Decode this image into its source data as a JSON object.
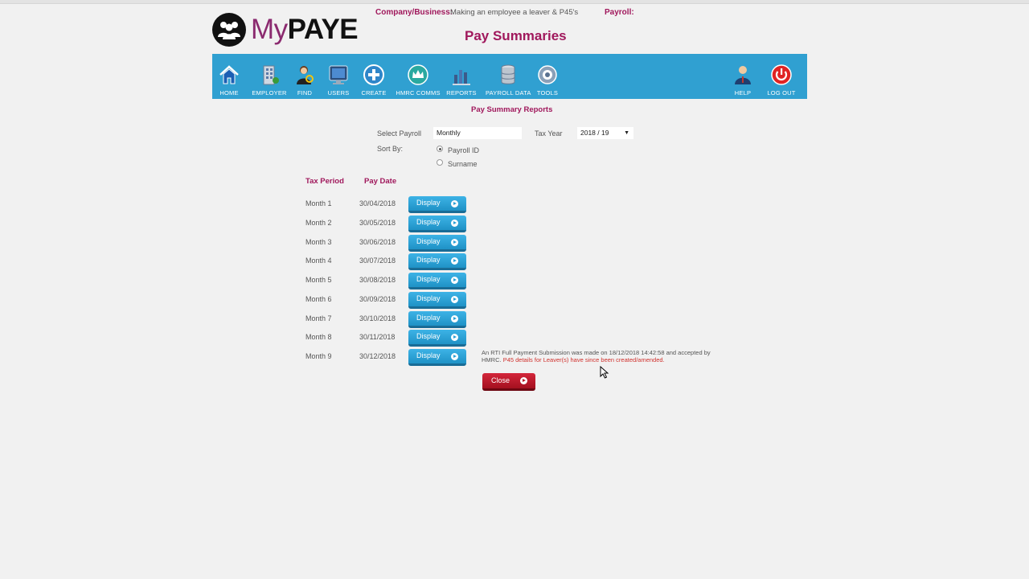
{
  "header": {
    "logo_my": "My",
    "logo_paye": "PAYE",
    "company_label": "Company/Business:",
    "company_value": "Making an employee a leaver & P45's",
    "payroll_label": "Payroll:",
    "payroll_value": "",
    "page_title": "Pay Summaries"
  },
  "toolbar": {
    "items": [
      {
        "label": "HOME",
        "icon": "home-icon"
      },
      {
        "label": "EMPLOYER",
        "icon": "building-icon"
      },
      {
        "label": "FIND",
        "icon": "person-search-icon"
      },
      {
        "label": "USERS",
        "icon": "users-monitor-icon"
      },
      {
        "label": "CREATE",
        "icon": "plus-circle-icon"
      },
      {
        "label": "HMRC COMMS",
        "icon": "crown-icon"
      },
      {
        "label": "REPORTS",
        "icon": "reports-chart-icon"
      },
      {
        "label": "PAYROLL DATA",
        "icon": "database-icon"
      },
      {
        "label": "TOOLS",
        "icon": "gear-icon"
      },
      {
        "label": "HELP",
        "icon": "help-person-icon"
      },
      {
        "label": "LOG OUT",
        "icon": "power-icon"
      }
    ],
    "background": "#30a0d1"
  },
  "form": {
    "section_title": "Pay Summary Reports",
    "select_payroll_label": "Select Payroll",
    "select_payroll_value": "Monthly",
    "tax_year_label": "Tax Year",
    "tax_year_value": "2018 / 19",
    "sort_by_label": "Sort By:",
    "sort_options": [
      {
        "label": "Payroll ID",
        "checked": true
      },
      {
        "label": "Surname",
        "checked": false
      }
    ]
  },
  "table": {
    "headers": [
      "Tax Period",
      "Pay Date"
    ],
    "button_label": "Display",
    "rows": [
      {
        "period": "Month 1",
        "date": "30/04/2018"
      },
      {
        "period": "Month 2",
        "date": "30/05/2018"
      },
      {
        "period": "Month 3",
        "date": "30/06/2018"
      },
      {
        "period": "Month 4",
        "date": "30/07/2018"
      },
      {
        "period": "Month 5",
        "date": "30/08/2018"
      },
      {
        "period": "Month 6",
        "date": "30/09/2018"
      },
      {
        "period": "Month 7",
        "date": "30/10/2018"
      },
      {
        "period": "Month 8",
        "date": "30/11/2018"
      },
      {
        "period": "Month 9",
        "date": "30/12/2018"
      }
    ]
  },
  "notice": {
    "text": "An RTI Full Payment Submission was made on 18/12/2018 14:42:58 and accepted by HMRC.",
    "warning": "P45 details for Leaver(s) have since been created/amended."
  },
  "close_label": "Close",
  "colors": {
    "accent": "#a0185c",
    "toolbar": "#30a0d1",
    "display_button": "#2aa0d6",
    "close_button": "#b81426",
    "warning": "#d0312d"
  }
}
